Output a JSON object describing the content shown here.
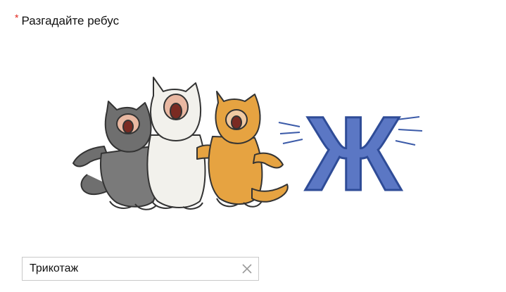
{
  "question": {
    "required_mark": "*",
    "label": "Разгадайте ребус"
  },
  "rebus": {
    "picture": "three singing cats followed by a blue letter",
    "letter": "Ж",
    "letter_color": "#5b77c4"
  },
  "answer": {
    "value": "Трикотаж",
    "clear_icon": "close-icon"
  },
  "colors": {
    "required": "#e2231a",
    "border": "#c9c9c9",
    "clear_icon": "#9a9a9a"
  }
}
